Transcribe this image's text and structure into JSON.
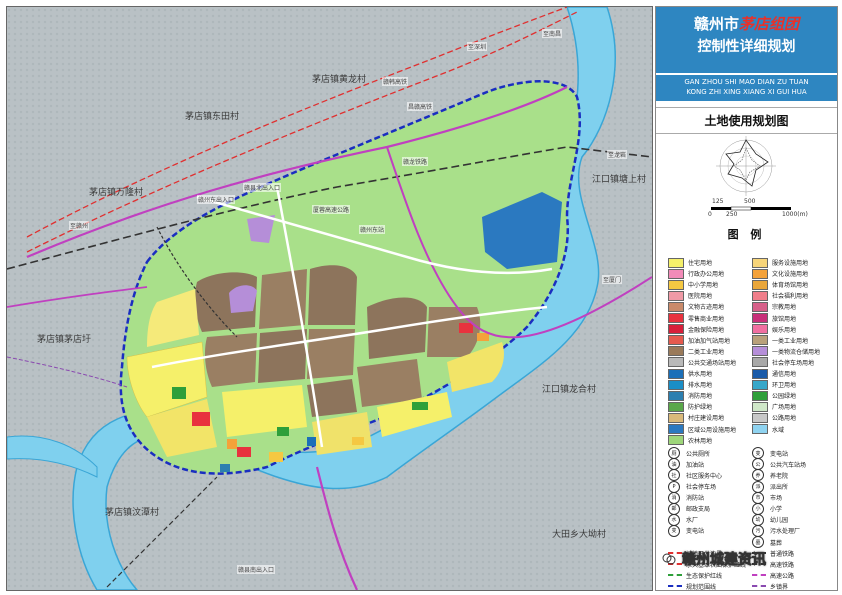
{
  "title": {
    "city": "赣州市",
    "town": "茅店组团",
    "plan": "控制性详细规划",
    "pinyin_1": "GAN ZHOU SHI MAO DIAN ZU TUAN",
    "pinyin_2": "KONG ZHI XING XIANG XI GUI HUA",
    "subtitle": "土地使用规划图"
  },
  "scale": {
    "ticks_top": [
      "125",
      "500"
    ],
    "ticks_bottom": [
      "0",
      "250",
      "1000(m)"
    ]
  },
  "legend_title": "图 例",
  "legend": {
    "left": [
      {
        "label": "住宅用地",
        "color": "#f5f06a"
      },
      {
        "label": "行政办公用地",
        "color": "#f28bb8"
      },
      {
        "label": "中小学用地",
        "color": "#f5c842"
      },
      {
        "label": "医院用地",
        "color": "#f09aa6"
      },
      {
        "label": "文物古迹用地",
        "color": "#c98a6a"
      },
      {
        "label": "零售商业用地",
        "color": "#e8323e"
      },
      {
        "label": "金融保险用地",
        "color": "#d81f3a"
      },
      {
        "label": "加油加气站用地",
        "color": "#e55a4e"
      },
      {
        "label": "二类工业用地",
        "color": "#9a7a5a"
      },
      {
        "label": "公共交通场站用地",
        "color": "#b9b9b9"
      },
      {
        "label": "供水用地",
        "color": "#1b6fb8"
      },
      {
        "label": "排水用地",
        "color": "#1b8ec6"
      },
      {
        "label": "消防用地",
        "color": "#2c7fb0"
      },
      {
        "label": "防护绿地",
        "color": "#5aa84a"
      },
      {
        "label": "村庄建设用地",
        "color": "#d9b97a"
      },
      {
        "label": "区域公用设施用地",
        "color": "#2b79c0"
      },
      {
        "label": "农林用地",
        "color": "#9ed67a"
      }
    ],
    "right": [
      {
        "label": "服务设施用地",
        "color": "#f7d57a"
      },
      {
        "label": "文化设施用地",
        "color": "#f4a23a"
      },
      {
        "label": "体育场馆用地",
        "color": "#e9a63a"
      },
      {
        "label": "社会福利用地",
        "color": "#f07e8a"
      },
      {
        "label": "宗教用地",
        "color": "#d7608a"
      },
      {
        "label": "旅馆用地",
        "color": "#c9307a"
      },
      {
        "label": "娱乐用地",
        "color": "#f06fa0"
      },
      {
        "label": "一类工业用地",
        "color": "#b8a07a"
      },
      {
        "label": "一类物流仓储用地",
        "color": "#b58ed8"
      },
      {
        "label": "社会停车场用地",
        "color": "#a9a9a9"
      },
      {
        "label": "通信用地",
        "color": "#1a5aa8"
      },
      {
        "label": "环卫用地",
        "color": "#37a7c9"
      },
      {
        "label": "公园绿地",
        "color": "#2e9f3a"
      },
      {
        "label": "广场用地",
        "color": "#cfe7c8"
      },
      {
        "label": "公路用地",
        "color": "#c8c8c8"
      },
      {
        "label": "水域",
        "color": "#8fd3f0"
      },
      {
        "label": "",
        "color": "#ffffff"
      }
    ],
    "icons_left": [
      {
        "label": "公共厕所",
        "symbol": "厕"
      },
      {
        "label": "加油站",
        "symbol": "油"
      },
      {
        "label": "社区服务中心",
        "symbol": "社"
      },
      {
        "label": "社会停车场",
        "symbol": "P"
      },
      {
        "label": "消防站",
        "symbol": "消"
      },
      {
        "label": "邮政支局",
        "symbol": "邮"
      },
      {
        "label": "水厂",
        "symbol": "水"
      },
      {
        "label": "变电站",
        "symbol": "变"
      }
    ],
    "icons_right": [
      {
        "label": "变电站",
        "symbol": "变"
      },
      {
        "label": "公共汽车站场",
        "symbol": "公"
      },
      {
        "label": "养老院",
        "symbol": "养"
      },
      {
        "label": "派出所",
        "symbol": "派"
      },
      {
        "label": "市场",
        "symbol": "市"
      },
      {
        "label": "小学",
        "symbol": "小"
      },
      {
        "label": "幼儿园",
        "symbol": "幼"
      },
      {
        "label": "污水处理厂",
        "symbol": "污"
      },
      {
        "label": "墓葬",
        "symbol": "墓"
      }
    ],
    "lines_left": [
      {
        "label": "城镇开发边界",
        "color": "#e03030"
      },
      {
        "label": "永久基本农田保护红线",
        "color": "#e03030"
      },
      {
        "label": "生态保护红线",
        "color": "#2e9f3a"
      },
      {
        "label": "规划范围线",
        "color": "#1a2ec0"
      }
    ],
    "lines_right": [
      {
        "label": "普通铁路",
        "color": "#333333"
      },
      {
        "label": "高速铁路",
        "color": "#333333"
      },
      {
        "label": "高速公路",
        "color": "#c040c0"
      },
      {
        "label": "乡镇界",
        "color": "#8a4ab0"
      }
    ]
  },
  "map_labels": {
    "villages": [
      "茅店镇黄龙村",
      "茅店镇东田村",
      "茅店镇万隆村",
      "江口镇塘上村",
      "茅店镇茅店圩",
      "江口镇龙合村",
      "茅店镇汶潭村",
      "大田乡大坳村"
    ],
    "roads": [
      "赣州东出入口",
      "赣县北出入口",
      "赣县南出入口",
      "赣韩高铁",
      "昌赣高铁",
      "赣龙铁路",
      "厦蓉高速公路",
      "赣州东站",
      "至深圳",
      "至南昌",
      "至赣州",
      "至厦门",
      "至龙岩"
    ]
  },
  "watermark": "赣州城建资讯",
  "colors": {
    "river": "#7fd0ee",
    "river_edge": "#3aa6d6",
    "farmland": "#a9e08a",
    "terrain": "#b7bfc3",
    "boundary": "#1a2ec0",
    "header": "#2e86c1"
  }
}
